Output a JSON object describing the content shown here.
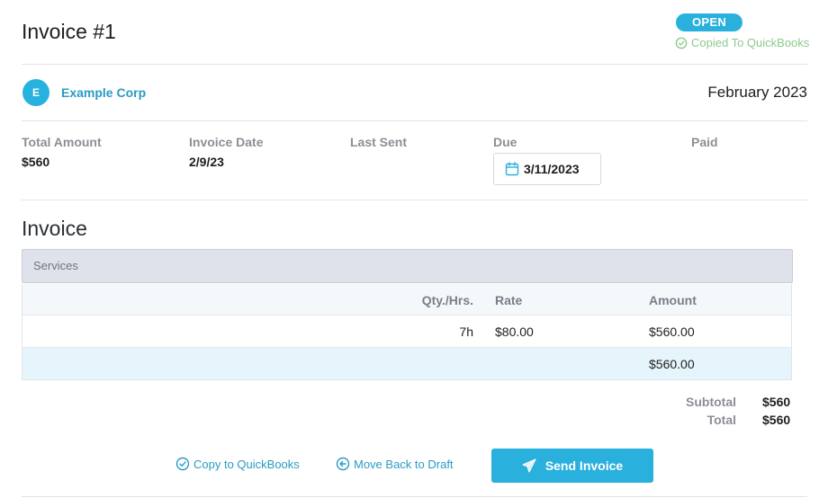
{
  "header": {
    "title": "Invoice #1",
    "status_badge": "OPEN",
    "qb_status": "Copied To QuickBooks"
  },
  "client": {
    "avatar_letter": "E",
    "name": "Example Corp",
    "period": "February 2023"
  },
  "meta": {
    "total_amount_label": "Total Amount",
    "total_amount_value": "$560",
    "invoice_date_label": "Invoice Date",
    "invoice_date_value": "2/9/23",
    "last_sent_label": "Last Sent",
    "due_label": "Due",
    "due_value": "3/11/2023",
    "paid_label": "Paid"
  },
  "invoice_section": {
    "title": "Invoice",
    "services_label": "Services",
    "columns": {
      "qty": "Qty./Hrs.",
      "rate": "Rate",
      "amount": "Amount"
    },
    "rows": [
      {
        "qty": "7h",
        "rate": "$80.00",
        "amount": "$560.00"
      }
    ],
    "row_total": "$560.00"
  },
  "summary": {
    "subtotal_label": "Subtotal",
    "subtotal_value": "$560",
    "total_label": "Total",
    "total_value": "$560"
  },
  "actions": {
    "copy_qb": "Copy to QuickBooks",
    "move_draft": "Move Back to Draft",
    "send": "Send Invoice"
  },
  "colors": {
    "accent": "#2ab0dd",
    "link": "#2a9bc4",
    "success": "#8cc98a"
  }
}
